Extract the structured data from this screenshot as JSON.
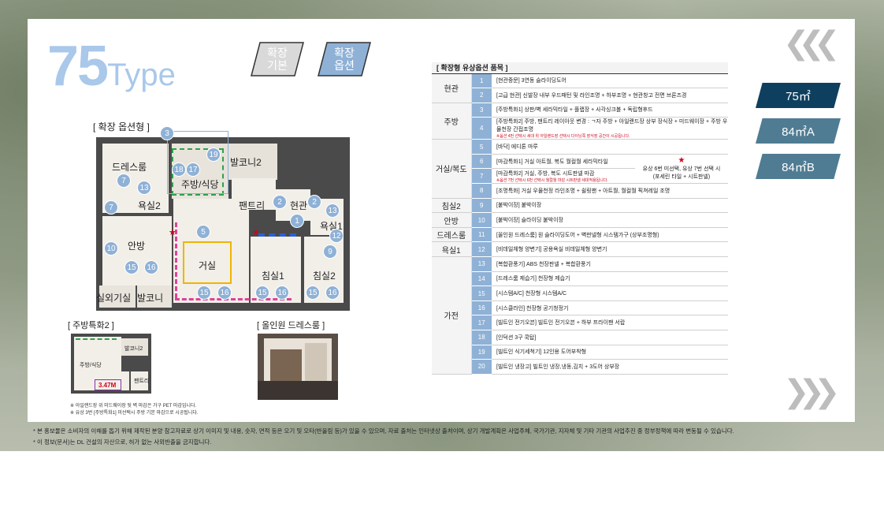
{
  "header": {
    "type_number": "75",
    "type_word": "Type",
    "option_basic": "확장\n기본",
    "option_extended": "확장\n옵션"
  },
  "plan": {
    "main_label": "[ 확장 옵션형 ]",
    "rooms": {
      "dressroom": "드레스룸",
      "kitchen": "주방/식당",
      "balcony2": "발코니2",
      "bath2": "욕실2",
      "pantry": "팬트리",
      "entrance": "현관",
      "bath1": "욕실1",
      "master": "안방",
      "living": "거실",
      "bed1": "침실1",
      "bed2": "침실2",
      "utility": "실외기실",
      "balcony": "발코니"
    },
    "kitchen_special_label": "[ 주방특화2 ]",
    "mini_labels": {
      "kitchen": "주방/식당",
      "balcony": "발코니2",
      "pantry": "팬트리",
      "dimension": "3.47M"
    },
    "allinone_label": "[ 올인원 드레스룸 ]",
    "notes": [
      "※ 아일랜드장 위 미드웨이장 뒷 벽 마감은 가구 PET 마감입니다.",
      "※ 유상 3번 [주방특화1] 미선택시 주방 기본 마감으로 시공됩니다."
    ]
  },
  "nav": {
    "prev_icon": "chevron-left-icon",
    "next_icon": "chevron-right-icon",
    "tabs": [
      {
        "label": "75㎡",
        "active": true
      },
      {
        "label": "84㎡A",
        "active": false
      },
      {
        "label": "84㎡B",
        "active": false
      }
    ],
    "active_color": "#0f3f5e",
    "inactive_color": "#4f7c93"
  },
  "options_table": {
    "title": "[ 확장형 유상옵션 품목 ]",
    "side_note_line1": "유상 6번 미선택, 유상 7번 선택 시",
    "side_note_line2": "(포세린 타일 + 시트판넬)",
    "rows": [
      {
        "cat": "현관",
        "span": 2,
        "num": "1",
        "desc": "[현관중문] 3연동 슬라이딩도어"
      },
      {
        "num": "2",
        "desc": "[고급 현관] 신발장 내부 우드패턴 및 라인조명 + 하부조명 + 현관창고 전면 브론즈경"
      },
      {
        "cat": "주방",
        "span": 2,
        "num": "3",
        "desc": "[주방특화1] 상판/벽 세라믹타일 + 플랩장 + 사각싱크볼 + 독립형후드"
      },
      {
        "num": "4",
        "desc": "[주방특화2] 주방, 팬트리 레이아웃 변경 : ㄱ자 주방 + 아일랜드장 상부 장식장 + 미드웨이장 + 주방 우물천장 간접조명",
        "note": "※옵션 4번 선택시 세대 위 아일랜드장 선택시 다이닝쪽 장식장 공간이 시공됩니다."
      },
      {
        "cat": "거실/복도",
        "span": 4,
        "num": "5",
        "desc": "[바닥] 에디톤 마루"
      },
      {
        "num": "6",
        "desc": "[마감특화1] 거실 아트월, 복도 월컬월 세라믹타일",
        "side": true
      },
      {
        "num": "7",
        "desc": "[마감특화2] 거실, 주방, 복도 시트판넬 마감",
        "note": "※옵션 7번 선택시 6번 선택시 월컬월 마감 시트판넬 세대적용됩니다."
      },
      {
        "num": "8",
        "desc": "[조명특화] 거실 우물천정 라인조명 + 쉴링팬 + 아트월, 월컬월 픽쳐레일 조명"
      },
      {
        "cat": "침실2",
        "span": 1,
        "num": "9",
        "desc": "[붙박이장] 붙박이장"
      },
      {
        "cat": "안방",
        "span": 1,
        "num": "10",
        "desc": "[붙박이장] 슬라이딩 붙박이장"
      },
      {
        "cat": "드레스룸",
        "span": 1,
        "num": "11",
        "desc": "[올인원 드레스룸] 원 슬라이딩도어 + 벽판넬형 시스템가구 (상부조명형)"
      },
      {
        "cat": "욕실1",
        "span": 1,
        "num": "12",
        "desc": "[비데일체형 양변기] 공용욕실 비데일체형 양변기"
      },
      {
        "cat": "가전",
        "span": 8,
        "num": "13",
        "desc": "[복합환풍기] ABS 천장판넬 + 복합환풍기"
      },
      {
        "num": "14",
        "desc": "[드레스룸 제습기] 천장형 제습기"
      },
      {
        "num": "15",
        "desc": "[시스템A/C] 천장형 시스템A/C"
      },
      {
        "num": "16",
        "desc": "[시스클라인] 천장형 공기청정기"
      },
      {
        "num": "17",
        "desc": "[빌트인 전기오븐] 빌트인 전기오븐 + 하부 프라이팬 서랍"
      },
      {
        "num": "18",
        "desc": "[인덕션 3구 쿡탑]"
      },
      {
        "num": "19",
        "desc": "[빌트인 식기세척기] 12인용 도어부착형"
      },
      {
        "num": "20",
        "desc": "[빌트인 냉장고] 빌트인 냉장,냉동,김치 + 3도어 상부장"
      }
    ]
  },
  "footnotes": [
    "* 본 홍보물은 소비자의 이해를 돕기 위해 제작된 분양 참고자료로 상기 이미지 및 내용, 숫자, 면적 등은 오기 및 오타(반올림 등)가 있을 수 있으며, 자료 출처는 인터넷상 출처이며, 상기 개발계획은 사업주체, 국가기관, 지자체 및 기타 기관의 사업추진 중 정부정책에 따라 변동될 수 있습니다.",
    "* 이 정보(문서)는 DL 건설의 자산으로, 허가 없는 사외반출을 금지합니다."
  ]
}
